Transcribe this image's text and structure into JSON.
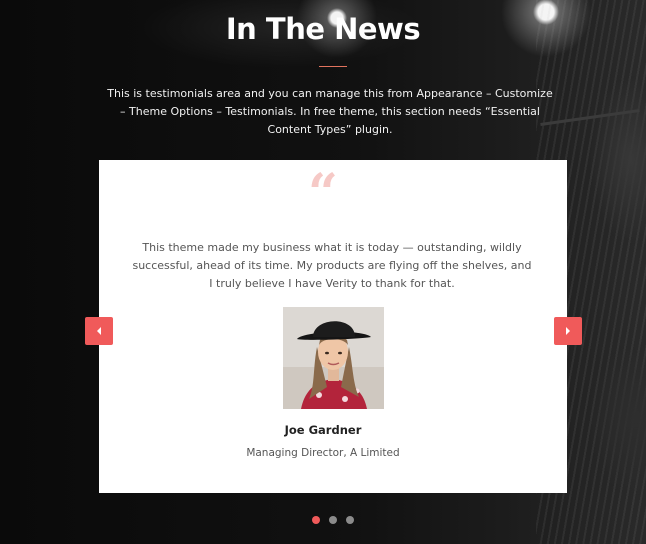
{
  "section": {
    "title": "In The News",
    "intro": "This is testimonials area and you can manage this from Appearance – Customize – Theme Options – Testimonials. In free theme, this section needs “Essential Content Types” plugin.",
    "accent_color": "#e2735e"
  },
  "testimonial": {
    "quote_mark": "“",
    "text": "This theme made my business what it is today — outstanding, wildly successful, ahead of its time. My products are flying off the shelves, and I truly believe I have Verity to thank for that.",
    "author_name": "Joe Gardner",
    "author_role": "Managing Director, A Limited",
    "quote_color": "#f6c9c6"
  },
  "slider": {
    "prev_icon": "chevron-left-icon",
    "next_icon": "chevron-right-icon",
    "arrow_color": "#f05a5a",
    "dots": [
      {
        "active": true
      },
      {
        "active": false
      },
      {
        "active": false
      }
    ]
  }
}
